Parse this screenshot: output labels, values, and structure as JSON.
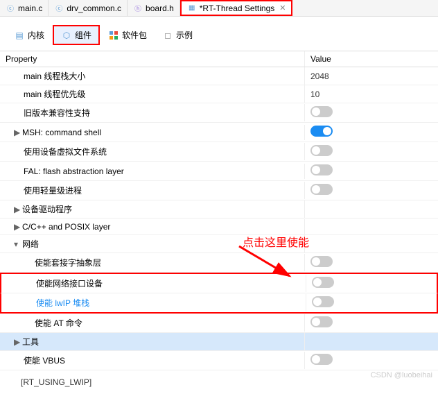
{
  "tabs": [
    {
      "icon": "c",
      "label": "main.c",
      "icon_color": "#5b9bd5"
    },
    {
      "icon": "c",
      "label": "drv_common.c",
      "icon_color": "#5b9bd5"
    },
    {
      "icon": "h",
      "label": "board.h",
      "icon_color": "#9370db"
    },
    {
      "icon": "⚙",
      "label": "*RT-Thread Settings",
      "icon_color": "#5b9bd5",
      "active": true,
      "highlighted": true
    }
  ],
  "sub_tabs": [
    {
      "label": "内核",
      "icon": "▤"
    },
    {
      "label": "组件",
      "icon": "📦",
      "active": true,
      "highlighted": true
    },
    {
      "label": "软件包",
      "icon": "⬛"
    },
    {
      "label": "示例",
      "icon": "📄"
    }
  ],
  "columns": {
    "property": "Property",
    "value": "Value"
  },
  "rows": [
    {
      "label": "main 线程栈大小",
      "indent": 0,
      "value_type": "text",
      "value": "2048"
    },
    {
      "label": "main 线程优先级",
      "indent": 0,
      "value_type": "text",
      "value": "10"
    },
    {
      "label": "旧版本兼容性支持",
      "indent": 0,
      "value_type": "toggle",
      "on": false
    },
    {
      "label": "MSH: command shell",
      "indent": 0,
      "expander": "▶",
      "value_type": "toggle",
      "on": true
    },
    {
      "label": "使用设备虚拟文件系统",
      "indent": 0,
      "value_type": "toggle",
      "on": false
    },
    {
      "label": "FAL: flash abstraction layer",
      "indent": 0,
      "value_type": "toggle",
      "on": false
    },
    {
      "label": "使用轻量级进程",
      "indent": 0,
      "value_type": "toggle",
      "on": false
    },
    {
      "label": "设备驱动程序",
      "indent": 0,
      "expander": "▶"
    },
    {
      "label": "C/C++ and POSIX layer",
      "indent": 0,
      "expander": "▶"
    },
    {
      "label": "网络",
      "indent": 0,
      "expander": "▾"
    },
    {
      "label": "使能套接字抽象层",
      "indent": 1,
      "value_type": "toggle",
      "on": false
    },
    {
      "label": "使能网络接口设备",
      "indent": 1,
      "value_type": "toggle",
      "on": false,
      "box_top": true
    },
    {
      "label": "使能 lwIP 堆栈",
      "indent": 1,
      "value_type": "toggle",
      "on": false,
      "link": true,
      "box_bottom": true
    },
    {
      "label": "使能 AT 命令",
      "indent": 1,
      "value_type": "toggle",
      "on": false
    },
    {
      "label": "工具",
      "indent": 0,
      "expander": "▶",
      "selected": true
    },
    {
      "label": "使能 VBUS",
      "indent": 0,
      "value_type": "toggle",
      "on": false
    }
  ],
  "annotation": "点击这里使能",
  "footer": "[RT_USING_LWIP]",
  "watermark": "CSDN @luobeihai"
}
